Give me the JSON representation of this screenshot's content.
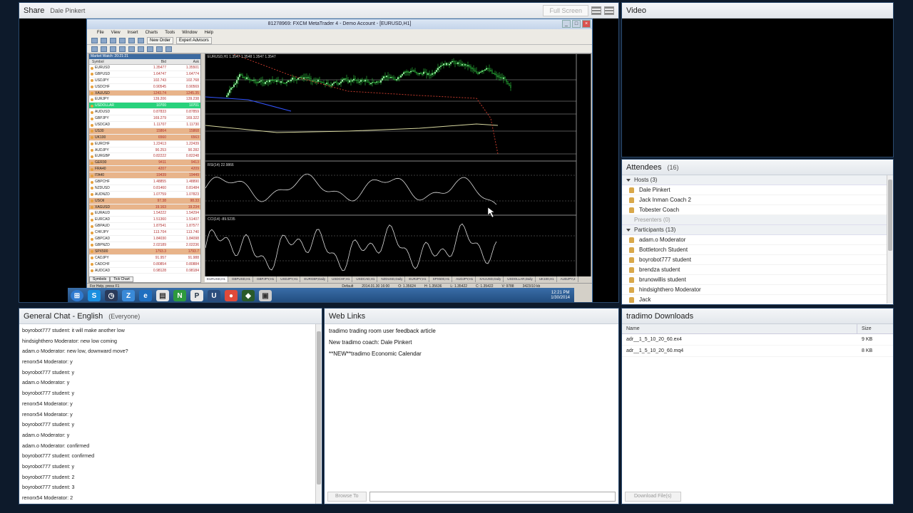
{
  "share": {
    "title": "Share",
    "presenter": "Dale Pinkert",
    "fullscreen_label": "Full Screen"
  },
  "mt4": {
    "window_title": "81278969: FXCM MetaTrader 4 - Demo Account - [EURUSD,H1]",
    "menu": [
      "File",
      "View",
      "Insert",
      "Charts",
      "Tools",
      "Window",
      "Help"
    ],
    "new_order_label": "New Order",
    "expert_advisors_label": "Expert Advisors",
    "market_watch_title": "Market Watch: 20:21:21",
    "columns": [
      "Symbol",
      "Bid",
      "Ask"
    ],
    "symbols": [
      {
        "sym": "EURUSD",
        "bid": "1.35477",
        "ask": "1.35501",
        "hl": ""
      },
      {
        "sym": "GBPUSD",
        "bid": "1.64747",
        "ask": "1.64774",
        "hl": ""
      },
      {
        "sym": "USDJPY",
        "bid": "102.743",
        "ask": "102.768",
        "hl": ""
      },
      {
        "sym": "USDCHF",
        "bid": "0.90545",
        "ask": "0.90569",
        "hl": ""
      },
      {
        "sym": "XAUUSD",
        "bid": "1243.74",
        "ask": "1245.35",
        "hl": "orange"
      },
      {
        "sym": "EURJPY",
        "bid": "139.206",
        "ask": "139.238",
        "hl": ""
      },
      {
        "sym": "USDOLLAR",
        "bid": "10700",
        "ask": "10701",
        "hl": "green"
      },
      {
        "sym": "AUDUSD",
        "bid": "0.87833",
        "ask": "0.87859",
        "hl": ""
      },
      {
        "sym": "GBPJPY",
        "bid": "169.279",
        "ask": "169.322",
        "hl": ""
      },
      {
        "sym": "USDCAD",
        "bid": "1.11707",
        "ask": "1.11730",
        "hl": ""
      },
      {
        "sym": "US30",
        "bid": "15864",
        "ask": "15868",
        "hl": "orange"
      },
      {
        "sym": "UK100",
        "bid": "6560",
        "ask": "6563",
        "hl": "orange"
      },
      {
        "sym": "EURCHF",
        "bid": "1.22413",
        "ask": "1.22439",
        "hl": ""
      },
      {
        "sym": "AUDJPY",
        "bid": "90.253",
        "ask": "90.282",
        "hl": ""
      },
      {
        "sym": "EURGBP",
        "bid": "0.82222",
        "ask": "0.82248",
        "hl": ""
      },
      {
        "sym": "GER30",
        "bid": "9411",
        "ask": "9413",
        "hl": "orange"
      },
      {
        "sym": "FRA40",
        "bid": "4207",
        "ask": "4209",
        "hl": "orange"
      },
      {
        "sym": "ITA40",
        "bid": "19439",
        "ask": "19449",
        "hl": "orange"
      },
      {
        "sym": "GBPCHF",
        "bid": "1.48855",
        "ask": "1.48890",
        "hl": ""
      },
      {
        "sym": "NZDUSD",
        "bid": "0.81460",
        "ask": "0.81484",
        "hl": ""
      },
      {
        "sym": "AUDNZD",
        "bid": "1.07759",
        "ask": "1.07823",
        "hl": ""
      },
      {
        "sym": "USOil",
        "bid": "97.38",
        "ask": "98.33",
        "hl": "orange"
      },
      {
        "sym": "XAGUSD",
        "bid": "19.163",
        "ask": "19.234",
        "hl": "orange"
      },
      {
        "sym": "EURAUD",
        "bid": "1.54222",
        "ask": "1.54294",
        "hl": ""
      },
      {
        "sym": "EURCAD",
        "bid": "1.51360",
        "ask": "1.51407",
        "hl": ""
      },
      {
        "sym": "GBPAUD",
        "bid": "1.87541",
        "ask": "1.87577",
        "hl": ""
      },
      {
        "sym": "CHFJPY",
        "bid": "113.704",
        "ask": "113.740",
        "hl": ""
      },
      {
        "sym": "GBPCAD",
        "bid": "1.84030",
        "ask": "1.84098",
        "hl": ""
      },
      {
        "sym": "GBPNZD",
        "bid": "2.02189",
        "ask": "2.02236",
        "hl": ""
      },
      {
        "sym": "SPX500",
        "bid": "1793.3",
        "ask": "1793.7",
        "hl": "orange"
      },
      {
        "sym": "CADJPY",
        "bid": "91.957",
        "ask": "91.988",
        "hl": ""
      },
      {
        "sym": "CADCHF",
        "bid": "0.80854",
        "ask": "0.80884",
        "hl": ""
      },
      {
        "sym": "AUDCAD",
        "bid": "0.98128",
        "ask": "0.98184",
        "hl": ""
      }
    ],
    "mw_tabs": [
      "Symbols",
      "Tick Chart"
    ],
    "chart_label": "EURUSD,H1  1.3547  1.3548  1.3547  1.3547",
    "rsi_label": "RSI(14) 22.9866",
    "cci_label": "CCI(14) -89.5235",
    "chart_tabs": [
      "EURUSD,H1",
      "GBPUSD,H1",
      "GBPJPY,H1",
      "USDJPY,H1",
      "EURGBP,Daily",
      "USDCHF,H1",
      "USDCAD,H1",
      "NZDUSD,Daily",
      "EURJPY,H1",
      "SPX500,H1",
      "AUDJPY,H1",
      "XAUUSD,Daily",
      "USDOLLAR,Daily",
      "UK100,H1",
      "AUDJPY,2"
    ],
    "status_help": "For Help, press F1",
    "status_profile": "Default",
    "status_time": "2014.01.30 16:00",
    "status_o": "O: 1.35624",
    "status_h": "H: 1.35636",
    "status_l": "L: 1.35422",
    "status_c": "C: 1.35422",
    "status_v": "V: 9788",
    "status_mem": "3423/10 kb",
    "clock_time": "12:21 PM",
    "clock_date": "1/30/2014"
  },
  "video": {
    "title": "Video"
  },
  "attendees": {
    "title": "Attendees",
    "count": "(16)",
    "hosts_label": "Hosts (3)",
    "hosts": [
      "Dale Pinkert",
      "Jack Inman Coach 2",
      "Tobester Coach"
    ],
    "presenters_label": "Presenters (0)",
    "participants_label": "Participants (13)",
    "participants": [
      "adam.o Moderator",
      "Bottletorch Student",
      "boyrobot777 student",
      "brendza student",
      "brunowillis student",
      "hindsighthero Moderator",
      "Jack"
    ]
  },
  "chat": {
    "title": "General Chat - English",
    "scope": "(Everyone)",
    "messages": [
      {
        "who": "boyrobot777 student:",
        "text": "it will make another low"
      },
      {
        "who": "hindsighthero Moderator:",
        "text": "new low coming"
      },
      {
        "who": "adam.o Moderator:",
        "text": "new low, downward move?"
      },
      {
        "who": "renorx54 Moderator:",
        "text": "y"
      },
      {
        "who": "boyrobot777 student:",
        "text": "y"
      },
      {
        "who": "adam.o Moderator:",
        "text": "y"
      },
      {
        "who": "boyrobot777 student:",
        "text": "y"
      },
      {
        "who": "renorx54 Moderator:",
        "text": "y"
      },
      {
        "who": "renorx54 Moderator:",
        "text": "y"
      },
      {
        "who": "boyrobot777 student:",
        "text": "y"
      },
      {
        "who": "adam.o Moderator:",
        "text": "y"
      },
      {
        "who": "adam.o Moderator:",
        "text": "confirmed"
      },
      {
        "who": "boyrobot777 student:",
        "text": "confirmed"
      },
      {
        "who": "boyrobot777 student:",
        "text": "y"
      },
      {
        "who": "boyrobot777 student:",
        "text": "2"
      },
      {
        "who": "boyrobot777 student:",
        "text": "3"
      },
      {
        "who": "renorx54 Moderator:",
        "text": "2"
      }
    ]
  },
  "links": {
    "title": "Web Links",
    "items": [
      "tradimo trading room user feedback article",
      "New tradimo coach: Dale Pinkert",
      "**NEW**tradimo Economic Calendar"
    ],
    "browse_label": "Browse To"
  },
  "downloads": {
    "title": "tradimo Downloads",
    "col_name": "Name",
    "col_size": "Size",
    "files": [
      {
        "name": "adr__1_5_10_20_60.ex4",
        "size": "9 KB"
      },
      {
        "name": "adr__1_5_10_20_60.mq4",
        "size": "8 KB"
      }
    ],
    "download_label": "Download File(s)"
  }
}
